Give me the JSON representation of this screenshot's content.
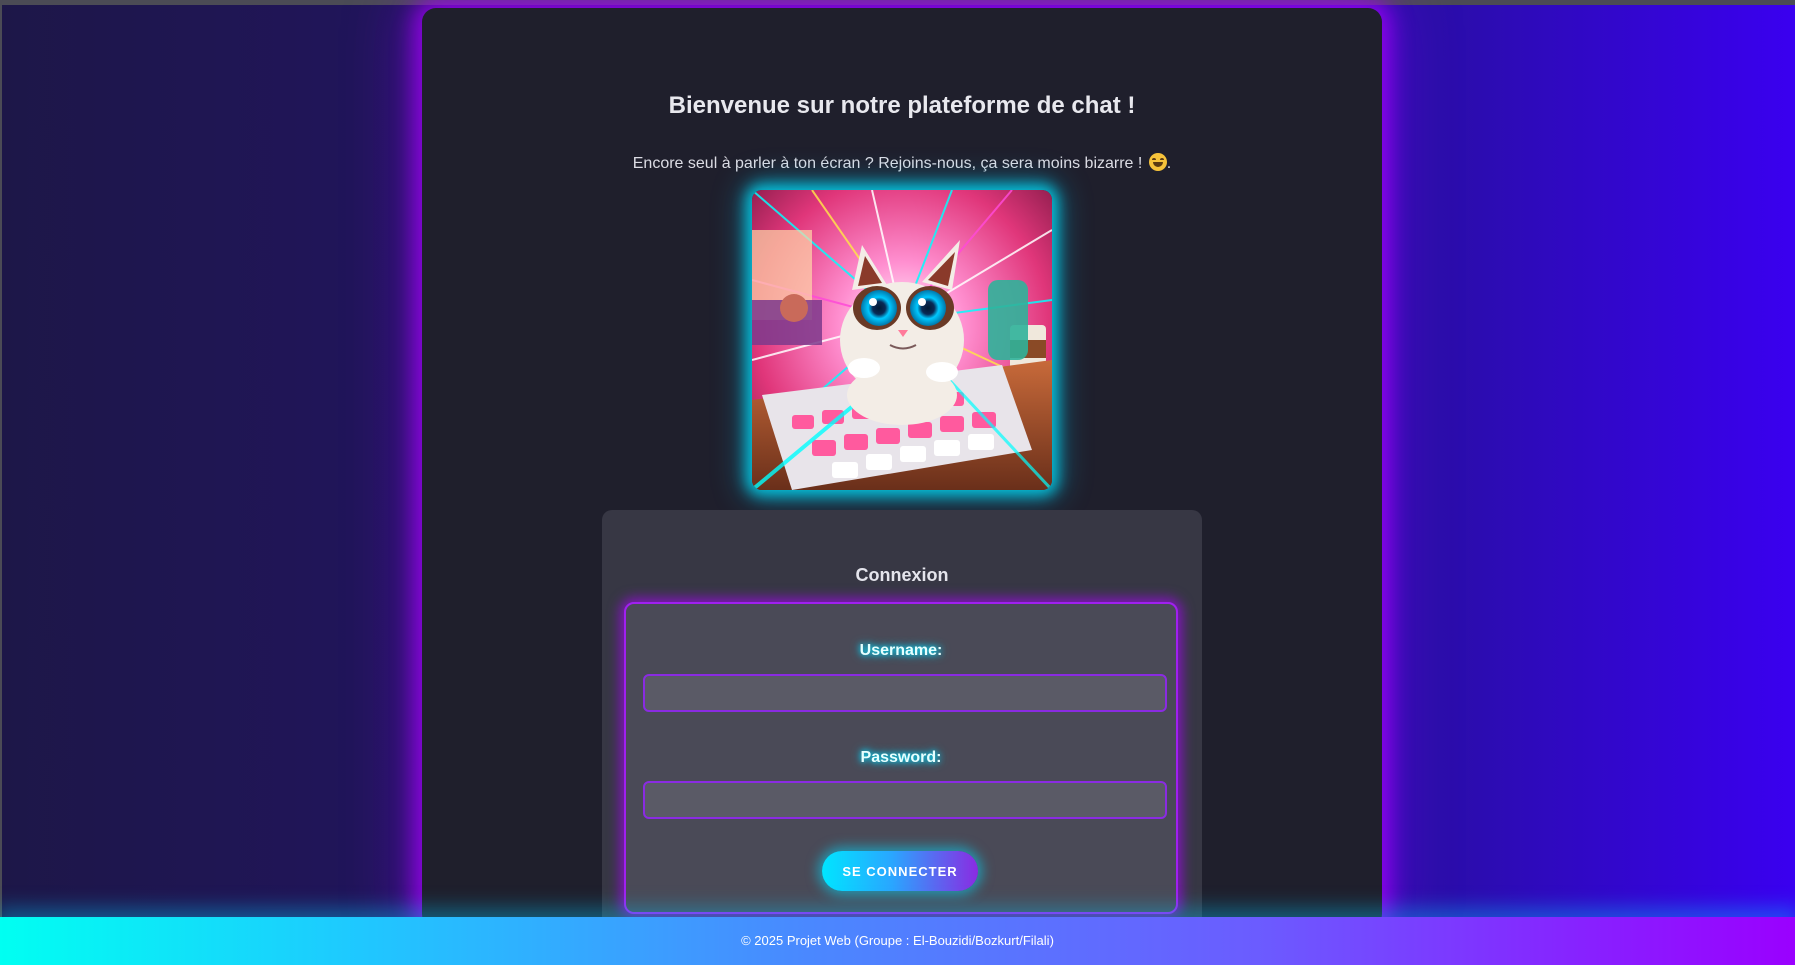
{
  "header": {
    "title": "Bienvenue sur notre plateforme de chat !",
    "subtitle": "Encore seul à parler à ton écran ? Rejoins-nous, ça sera moins bizarre !",
    "subtitle_suffix": ".",
    "emoji": "grinning-face-emoji"
  },
  "hero_image": {
    "alt": "cat-at-keyboard-illustration"
  },
  "login": {
    "title": "Connexion",
    "username_label": "Username:",
    "username_value": "",
    "password_label": "Password:",
    "password_value": "",
    "submit_label": "SE CONNECTER"
  },
  "footer": {
    "text": "© 2025 Projet Web (Groupe : El-Bouzidi/Bozkurt/Filali)"
  },
  "colors": {
    "accent_cyan": "#00e5ff",
    "accent_purple": "#a020f0",
    "card_bg": "#1f1f2c",
    "page_bg_start": "#1d1748",
    "page_bg_end": "#3a00f0"
  }
}
